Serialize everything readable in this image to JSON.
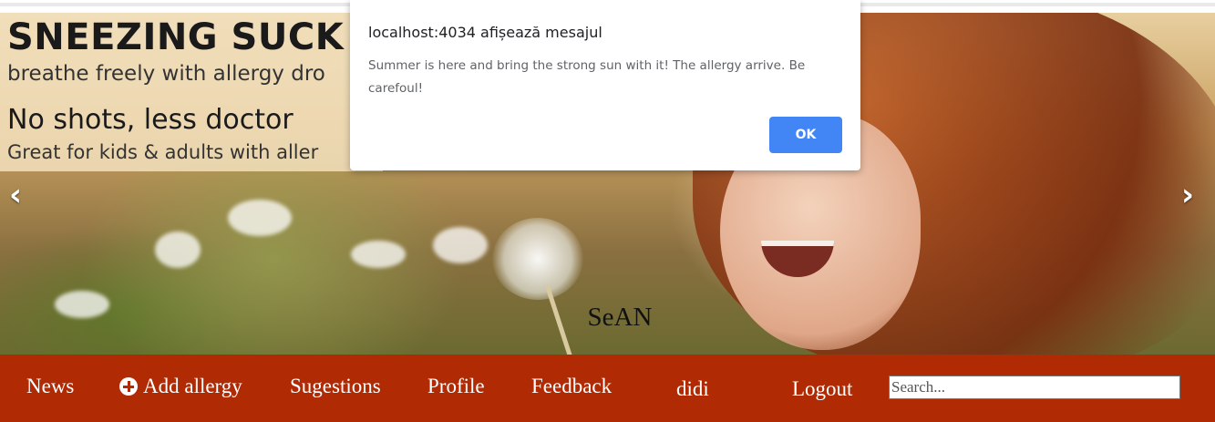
{
  "alert": {
    "title": "localhost:4034 afișează mesajul",
    "message": "Summer is here and bring the strong sun with it! The allergy arrive. Be carefoul!",
    "ok_label": "OK"
  },
  "carousel": {
    "banner": {
      "title": "SNEEZING SUCK",
      "subtitle": "breathe freely with allergy dro",
      "line2": "No shots, less doctor",
      "line3": "Great for kids & adults with aller"
    },
    "prev_icon": "‹",
    "next_icon": "›",
    "caption": "SeAN"
  },
  "navbar": {
    "items": [
      {
        "label": "News",
        "icon": null
      },
      {
        "label": "Add allergy",
        "icon": "plus-circle-icon"
      },
      {
        "label": "Sugestions",
        "icon": null
      },
      {
        "label": "Profile",
        "icon": null
      },
      {
        "label": "Feedback",
        "icon": null
      },
      {
        "label": "didi",
        "icon": null
      },
      {
        "label": "Logout",
        "icon": null
      }
    ],
    "search": {
      "placeholder": "Search..."
    },
    "background_color": "#b02a04"
  }
}
